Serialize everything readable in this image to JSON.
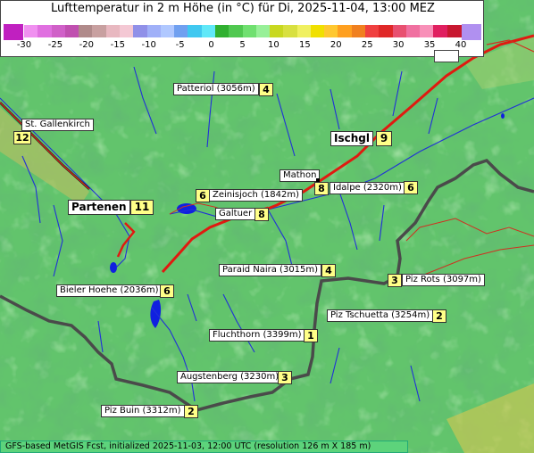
{
  "header": {
    "title": "Lufttemperatur in 2 m Höhe (in °C) für Di, 2025-11-04, 13:00 MEZ"
  },
  "scale": {
    "ticks": [
      "-30",
      "-25",
      "-20",
      "-15",
      "-10",
      "-5",
      "0",
      "5",
      "10",
      "15",
      "20",
      "25",
      "30",
      "35",
      "40"
    ],
    "colors": [
      "#f090f0",
      "#e070e0",
      "#d060c8",
      "#c050b0",
      "#b08a8a",
      "#c8a0a0",
      "#e8b8c0",
      "#f4c8d4",
      "#9090e8",
      "#a0b0f8",
      "#b0c8ff",
      "#70a0f0",
      "#40c8f0",
      "#60e8f8",
      "#30b030",
      "#50c850",
      "#70e070",
      "#98f098",
      "#c8d820",
      "#d8e040",
      "#f0f060",
      "#f0e000",
      "#ffc830",
      "#ffa020",
      "#f08020",
      "#f04040",
      "#e02828",
      "#e85070",
      "#f070a0",
      "#f890b8",
      "#e02060",
      "#c81830"
    ],
    "low_color": "#c020c0",
    "high_color": "#b090f0"
  },
  "places": [
    {
      "id": "patteriol",
      "label": "Patteriol (3056m)",
      "num": "4"
    },
    {
      "id": "st-gallenkirch",
      "label": "St. Gallenkirch",
      "num": "12"
    },
    {
      "id": "ischgl",
      "label": "Ischgl",
      "num": "9"
    },
    {
      "id": "mathon",
      "label": "Mathon",
      "num": "8"
    },
    {
      "id": "idalpe",
      "label": "Idalpe (2320m)",
      "num": "6"
    },
    {
      "id": "zeinisjoch",
      "label": "Zeinisjoch (1842m)",
      "num": "6"
    },
    {
      "id": "partenen",
      "label": "Partenen",
      "num": "11"
    },
    {
      "id": "galtuer",
      "label": "Galtuer",
      "num": "8"
    },
    {
      "id": "paraid-naira",
      "label": "Paraid Naira (3015m)",
      "num": "4"
    },
    {
      "id": "piz-rots",
      "label": "Piz Rots (3097m)",
      "num": "3"
    },
    {
      "id": "bieler-hoehe",
      "label": "Bieler Hoehe (2036m)",
      "num": "6"
    },
    {
      "id": "piz-tschuetta",
      "label": "Piz Tschuetta (3254m)",
      "num": "2"
    },
    {
      "id": "fluchthorn",
      "label": "Fluchthorn (3399m)",
      "num": "1"
    },
    {
      "id": "augstenberg",
      "label": "Augstenberg (3230m)",
      "num": "3"
    },
    {
      "id": "piz-buin",
      "label": "Piz Buin (3312m)",
      "num": "2"
    }
  ],
  "footer": {
    "text": "GFS-based MetGIS Fcst, initialized 2025-11-03, 12:00 UTC  (resolution 126 m X 185 m)"
  }
}
